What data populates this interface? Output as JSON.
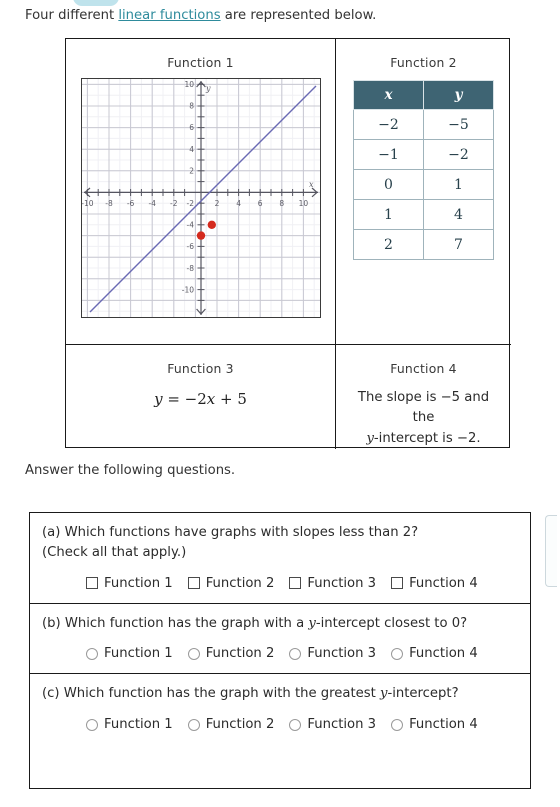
{
  "intro": {
    "before": "Four different ",
    "link": "linear functions",
    "after": " are represented below."
  },
  "functions": {
    "f1": {
      "title": "Function 1",
      "graph": {
        "xlabel": "x",
        "ylabel": "y",
        "x_ticks": [
          -10,
          -8,
          -6,
          -4,
          -2,
          2,
          4,
          6,
          8,
          10
        ],
        "y_ticks": [
          -10,
          -8,
          -6,
          -4,
          -2,
          2,
          4,
          6,
          8,
          10
        ],
        "xlim": [
          -11,
          11
        ],
        "ylim": [
          -11,
          11
        ],
        "line_color": "#6a6ab4",
        "point_color": "#d42a1e",
        "points": [
          [
            0,
            -4
          ],
          [
            1,
            -3
          ]
        ],
        "slope": 1,
        "y_intercept": -4
      }
    },
    "f2": {
      "title": "Function 2",
      "table": {
        "headers": [
          "x",
          "y"
        ],
        "rows": [
          [
            "−2",
            "−5"
          ],
          [
            "−1",
            "−2"
          ],
          [
            "0",
            "1"
          ],
          [
            "1",
            "4"
          ],
          [
            "2",
            "7"
          ]
        ],
        "header_bg": "#3e6473"
      }
    },
    "f3": {
      "title": "Function 3",
      "equation_parts": {
        "y": "y",
        "eq": " = −2",
        "x": "x",
        "tail": " + 5"
      },
      "equation": "y = −2x + 5"
    },
    "f4": {
      "title": "Function 4",
      "line1": "The slope is −5 and the",
      "line2_var": "y",
      "line2_rest": "-intercept is −2."
    }
  },
  "answer_prompt": "Answer the following questions.",
  "questions": [
    {
      "label": "(a) Which functions have graphs with slopes less than 2?",
      "sublabel": "(Check all that apply.)",
      "input_type": "checkbox",
      "options": [
        "Function 1",
        "Function 2",
        "Function 3",
        "Function 4"
      ]
    },
    {
      "label_pre": "(b) Which function has the graph with a ",
      "label_var": "y",
      "label_post": "-intercept closest to 0?",
      "input_type": "radio",
      "options": [
        "Function 1",
        "Function 2",
        "Function 3",
        "Function 4"
      ]
    },
    {
      "label_pre": "(c) Which function has the graph with the greatest ",
      "label_var": "y",
      "label_post": "-intercept?",
      "input_type": "radio",
      "options": [
        "Function 1",
        "Function 2",
        "Function 3",
        "Function 4"
      ]
    }
  ],
  "chart_data": {
    "type": "line",
    "title": "Function 1",
    "xlabel": "x",
    "ylabel": "y",
    "xlim": [
      -11,
      11
    ],
    "ylim": [
      -11,
      11
    ],
    "grid": true,
    "series": [
      {
        "name": "Function 1 line",
        "equation": "y = x - 4",
        "slope": 1,
        "intercept": -4,
        "color": "#6a6ab4",
        "x": [
          -7,
          11
        ],
        "y": [
          -11,
          7
        ]
      }
    ],
    "markers": [
      {
        "x": 0,
        "y": -4,
        "color": "#d42a1e"
      },
      {
        "x": 1,
        "y": -3,
        "color": "#d42a1e"
      }
    ],
    "x_ticks": [
      -10,
      -8,
      -6,
      -4,
      -2,
      2,
      4,
      6,
      8,
      10
    ],
    "y_ticks": [
      -10,
      -8,
      -6,
      -4,
      -2,
      2,
      4,
      6,
      8,
      10
    ]
  }
}
